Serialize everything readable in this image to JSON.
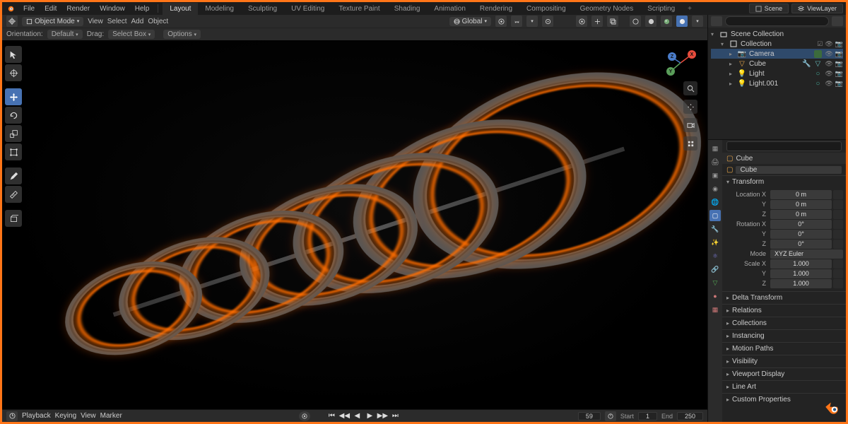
{
  "top_menu": {
    "items": [
      "File",
      "Edit",
      "Render",
      "Window",
      "Help"
    ],
    "scene_label": "Scene",
    "viewlayer_label": "ViewLayer"
  },
  "workspaces": {
    "tabs": [
      "Layout",
      "Modeling",
      "Sculpting",
      "UV Editing",
      "Texture Paint",
      "Shading",
      "Animation",
      "Rendering",
      "Compositing",
      "Geometry Nodes",
      "Scripting"
    ],
    "active": "Layout"
  },
  "viewport_header": {
    "mode": "Object Mode",
    "menus": [
      "View",
      "Select",
      "Add",
      "Object"
    ],
    "transform_orientation": "Global",
    "options_label": "Options"
  },
  "viewport_header2": {
    "orientation_label": "Orientation:",
    "orientation_value": "Default",
    "drag_label": "Drag:",
    "drag_value": "Select Box"
  },
  "outliner": {
    "root": "Scene Collection",
    "collection": "Collection",
    "items": [
      {
        "name": "Camera",
        "icon": "camera",
        "color": "#e9a74a",
        "selected": true
      },
      {
        "name": "Cube",
        "icon": "mesh",
        "color": "#e9a74a"
      },
      {
        "name": "Light",
        "icon": "light",
        "color": "#e9a74a"
      },
      {
        "name": "Light.001",
        "icon": "light",
        "color": "#e9a74a"
      }
    ]
  },
  "properties": {
    "object_name": "Cube",
    "transform": {
      "header": "Transform",
      "location": {
        "label": "Location",
        "x": "0 m",
        "y": "0 m",
        "z": "0 m",
        "ax": "X",
        "ay": "Y",
        "az": "Z"
      },
      "rotation": {
        "label": "Rotation",
        "x": "0°",
        "y": "0°",
        "z": "0°",
        "ax": "X",
        "ay": "Y",
        "az": "Z"
      },
      "mode_label": "Mode",
      "mode_value": "XYZ Euler",
      "scale": {
        "label": "Scale",
        "x": "1.000",
        "y": "1.000",
        "z": "1.000",
        "ax": "X",
        "ay": "Y",
        "az": "Z"
      }
    },
    "panels": [
      "Delta Transform",
      "Relations",
      "Collections",
      "Instancing",
      "Motion Paths",
      "Visibility",
      "Viewport Display",
      "Line Art",
      "Custom Properties"
    ]
  },
  "timeline": {
    "menus": [
      "Playback",
      "Keying",
      "View",
      "Marker"
    ],
    "current_frame": "59",
    "start_label": "Start",
    "start": "1",
    "end_label": "End",
    "end": "250"
  }
}
